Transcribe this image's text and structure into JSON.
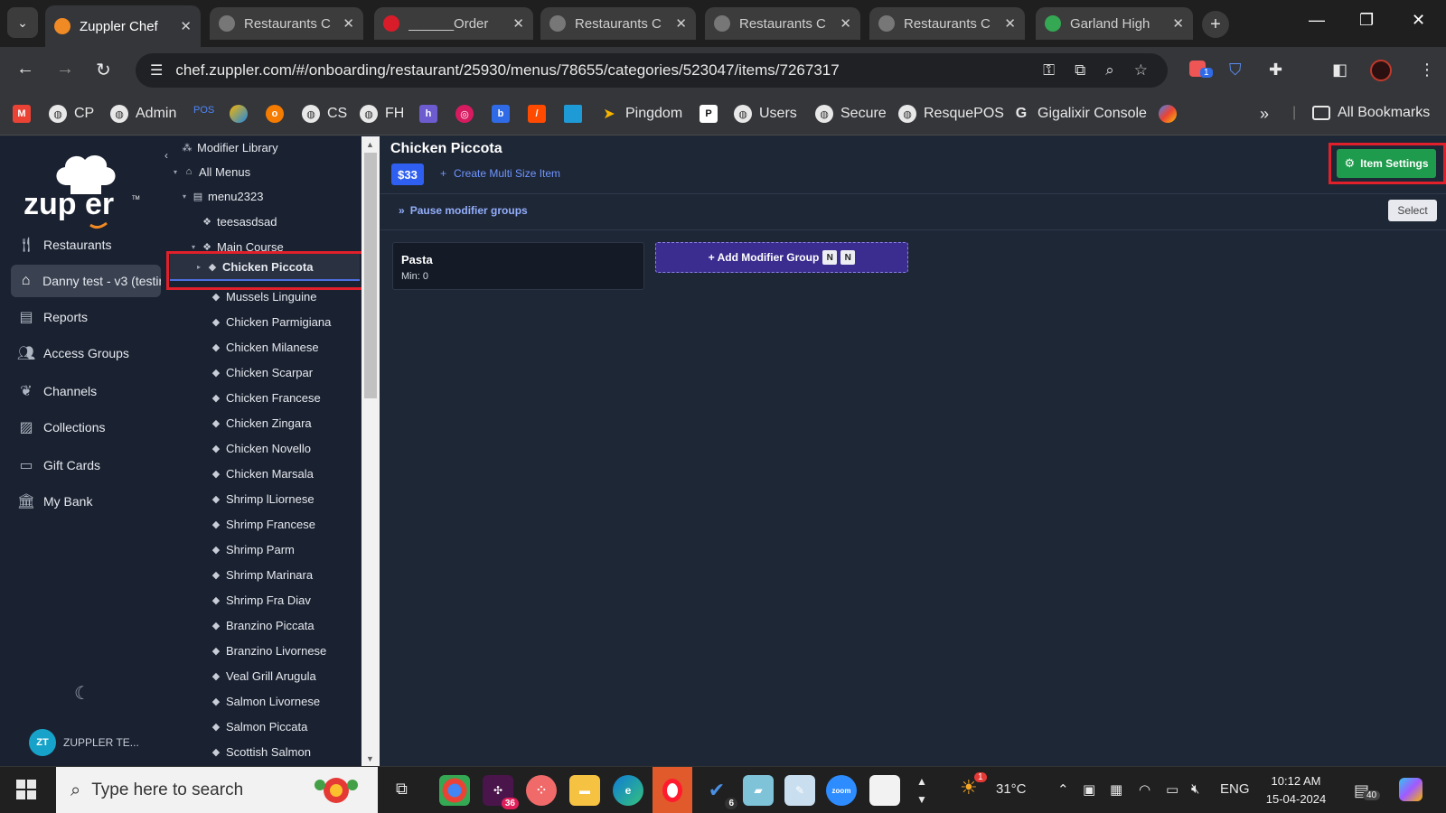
{
  "browser": {
    "tabs": [
      {
        "label": "Zuppler Chef",
        "active": true
      },
      {
        "label": "Restaurants C",
        "active": false
      },
      {
        "label": "______Order",
        "active": false
      },
      {
        "label": "Restaurants C",
        "active": false
      },
      {
        "label": "Restaurants C",
        "active": false
      },
      {
        "label": "Restaurants C",
        "active": false
      },
      {
        "label": "Garland High",
        "active": false
      }
    ],
    "url": "chef.zuppler.com/#/onboarding/restaurant/25930/menus/78655/categories/523047/items/7267317",
    "extension_badge": "1",
    "bookmarks": [
      {
        "label": "CP"
      },
      {
        "label": "Admin"
      },
      {
        "label": "POS"
      },
      {
        "label": "CS"
      },
      {
        "label": "FH"
      },
      {
        "label": "Pingdom"
      },
      {
        "label": "Users"
      },
      {
        "label": "Secure"
      },
      {
        "label": "ResquePOS"
      },
      {
        "label": "Gigalixir Console"
      }
    ],
    "all_bookmarks_label": "All Bookmarks",
    "overflow_label": "»"
  },
  "logo": {
    "text": "zup er",
    "tm": "TM"
  },
  "nav": {
    "items": [
      {
        "label": "Restaurants",
        "icon": "utensils-icon"
      },
      {
        "label": "Danny test - v3 (testin",
        "icon": "home-icon"
      },
      {
        "label": "Reports",
        "icon": "chart-icon"
      },
      {
        "label": "Access Groups",
        "icon": "users-icon"
      },
      {
        "label": "Channels",
        "icon": "leaf-icon"
      },
      {
        "label": "Collections",
        "icon": "images-icon"
      },
      {
        "label": "Gift Cards",
        "icon": "card-icon"
      },
      {
        "label": "My Bank",
        "icon": "bank-icon"
      }
    ],
    "user_initials": "ZT",
    "user_name": "ZUPPLER TE..."
  },
  "tree": {
    "modifier_library": "Modifier Library",
    "all_menus": "All Menus",
    "menu": "menu2323",
    "category_1": "teesasdsad",
    "category_2": "Main Course",
    "selected_item": "Chicken Piccota",
    "items": [
      "Mussels Linguine",
      "Chicken Parmigiana",
      "Chicken Milanese",
      "Chicken Scarpar",
      "Chicken Francese",
      "Chicken Zingara",
      "Chicken Novello",
      "Chicken Marsala",
      "Shrimp lLiornese",
      "Shrimp Francese",
      "Shrimp Parm",
      "Shrimp Marinara",
      "Shrimp Fra Diav",
      "Branzino Piccata",
      "Branzino Livornese",
      "Veal Grill Arugula",
      "Salmon Livornese",
      "Salmon Piccata",
      "Scottish Salmon"
    ]
  },
  "main": {
    "title": "Chicken Piccota",
    "price": "$33",
    "create_multi_size": "Create Multi Size Item",
    "item_settings": "Item Settings",
    "pause_modifier_groups": "Pause modifier groups",
    "select": "Select",
    "modifier_group": {
      "name": "Pasta",
      "min": "Min: 0"
    },
    "add_modifier_group": "+ Add Modifier Group",
    "kbd_1": "N",
    "kbd_2": "N"
  },
  "taskbar": {
    "search_placeholder": "Type here to search",
    "slack_badge": "36",
    "todo_badge": "6",
    "weather_badge": "1",
    "temperature": "31°C",
    "language": "ENG",
    "time": "10:12 AM",
    "date": "15-04-2024",
    "notification_count": "40"
  },
  "colors": {
    "accent": "#2f5ff0",
    "success": "#1e9b4c",
    "highlight": "#e0202a",
    "sidebar": "#1a2130",
    "content": "#1e2736"
  }
}
